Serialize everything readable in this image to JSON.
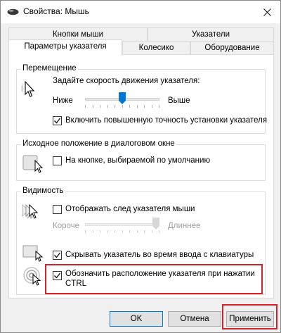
{
  "window": {
    "title": "Свойства: Мышь",
    "title_icon": "mouse-icon",
    "close_icon": "close-icon"
  },
  "tabs_top": [
    {
      "label": "Кнопки мыши"
    },
    {
      "label": "Указатели"
    }
  ],
  "tabs_bottom": [
    {
      "label": "Параметры указателя",
      "active": true
    },
    {
      "label": "Колесико"
    },
    {
      "label": "Оборудование"
    }
  ],
  "motion": {
    "title": "Перемещение",
    "speed_label": "Задайте скорость движения указателя:",
    "slow": "Ниже",
    "fast": "Выше",
    "speed_level": 0.5,
    "precision_label": "Включить повышенную точность установки указателя",
    "precision_checked": true
  },
  "snap": {
    "title": "Исходное положение в диалоговом окне",
    "label": "На кнопке, выбираемой по умолчанию",
    "checked": false
  },
  "visibility": {
    "title": "Видимость",
    "trails_label": "Отображать след указателя мыши",
    "trails_checked": false,
    "short": "Короче",
    "long": "Длиннее",
    "trails_level": 1.0,
    "hide_label": "Скрывать указатель во время ввода с клавиатуры",
    "hide_checked": true,
    "ctrl_label_line1": "Обозначить расположение указателя при нажатии",
    "ctrl_label_line2": "CTRL",
    "ctrl_checked": true
  },
  "buttons": {
    "ok": "OK",
    "cancel": "Отмена",
    "apply": "Применить"
  },
  "colors": {
    "highlight": "#d6202b",
    "accent": "#0078d7"
  }
}
